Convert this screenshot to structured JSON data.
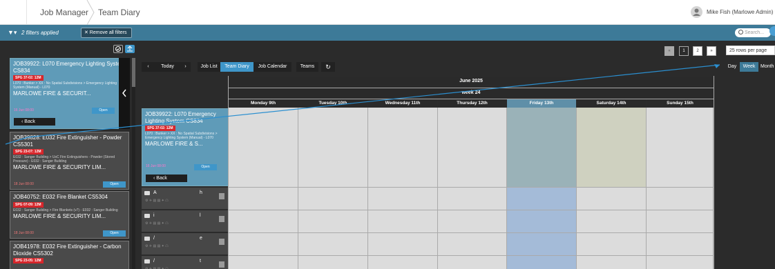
{
  "breadcrumb": {
    "items": [
      "Job Manager",
      "Team Diary"
    ]
  },
  "user": {
    "name": "Mike Fish (Marlowe Admin) ▾"
  },
  "filters": {
    "applied": "2 filters applied",
    "remove": "✕ Remove all filters"
  },
  "search": {
    "placeholder": "Search..."
  },
  "list": {
    "back": "Back",
    "cards": [
      {
        "title": "JOB39922: L070 Emergency Lighting System CS834",
        "tag": "SPG 37-02: 12M",
        "location": "L070 : Bunker > XX : No Spatial Subdivisions > Emergency Lighting System (Manual) - L070",
        "customer": "MARLOWE FIRE & SECURIT...",
        "count": "0",
        "date": "16 Jun 08:00",
        "status": "Open"
      },
      {
        "title": "JOB39828: E032 Fire Extinguisher - Powder CS5301",
        "tag": "SPG 23-07: 12M",
        "location": "E032 : Sanger Building > UsC Fire Extinguishers - Powder (Stored Pressure) - E032 : Sanger Building",
        "customer": "MARLOWE FIRE & SECURITY LIM...",
        "count": "0",
        "date": "18 Jun 08:00",
        "status": "Open"
      },
      {
        "title": "JOB40752: E032 Fire Blanket CS5304",
        "tag": "SPG 07-09: 12M",
        "location": "E032 : Sanger Building > Fire Blankets (v7) - E032 : Sanger Building",
        "customer": "MARLOWE FIRE & SECURITY LIM...",
        "count": "0",
        "date": "18 Jun 08:00",
        "status": "Open"
      },
      {
        "title": "JOB41978: E032 Fire Extinguisher - Carbon Dioxide CS5302",
        "tag": "SPG 23-05: 12M"
      }
    ]
  },
  "toolbar": {
    "prev": "‹",
    "today": "Today",
    "next": "›",
    "job_list": "Job List",
    "team_diary": "Team Diary",
    "job_calendar": "Job Calendar",
    "teams": "Teams",
    "refresh": "↻"
  },
  "view_modes": [
    "Day",
    "Week",
    "Month"
  ],
  "pagination": {
    "prev": "«",
    "pages": [
      "1",
      "2"
    ],
    "next": "»",
    "rows_per_page": "25 rows per page"
  },
  "calendar": {
    "month": "June 2025",
    "week": "week 24",
    "days": [
      "Monday 9th",
      "Tuesday 10th",
      "Wednesday 11th",
      "Thursday 12th",
      "Friday 13th",
      "Saturday 14th",
      "Sunday 15th"
    ]
  },
  "drag_card": {
    "title": "JOB39922: L070 Emergency Lighting System CS834",
    "tag": "SPG 37-02: 12M",
    "location": "L070 : Bunker > XX : No Spatial Subdivisions > Emergency Lighting System (Manual) - L070",
    "customer": "MARLOWE FIRE & S...",
    "count": "0",
    "date": "16 Jun 08:00",
    "status": "Open",
    "back": "Back"
  },
  "resources": [
    {
      "name": "A",
      "suffix": "h"
    },
    {
      "name": "i",
      "suffix": "l"
    },
    {
      "name": "/",
      "suffix": "e"
    },
    {
      "name": "/",
      "suffix": "t"
    }
  ],
  "colors": {
    "header": "#3d7a98",
    "selected_card": "#5f9bb8",
    "today_col": "#a4bbd8",
    "weekend_sat": "#cfd1c0",
    "tag": "#d7262b",
    "open": "#3f96c9",
    "arrow": "#2b8fd0"
  }
}
